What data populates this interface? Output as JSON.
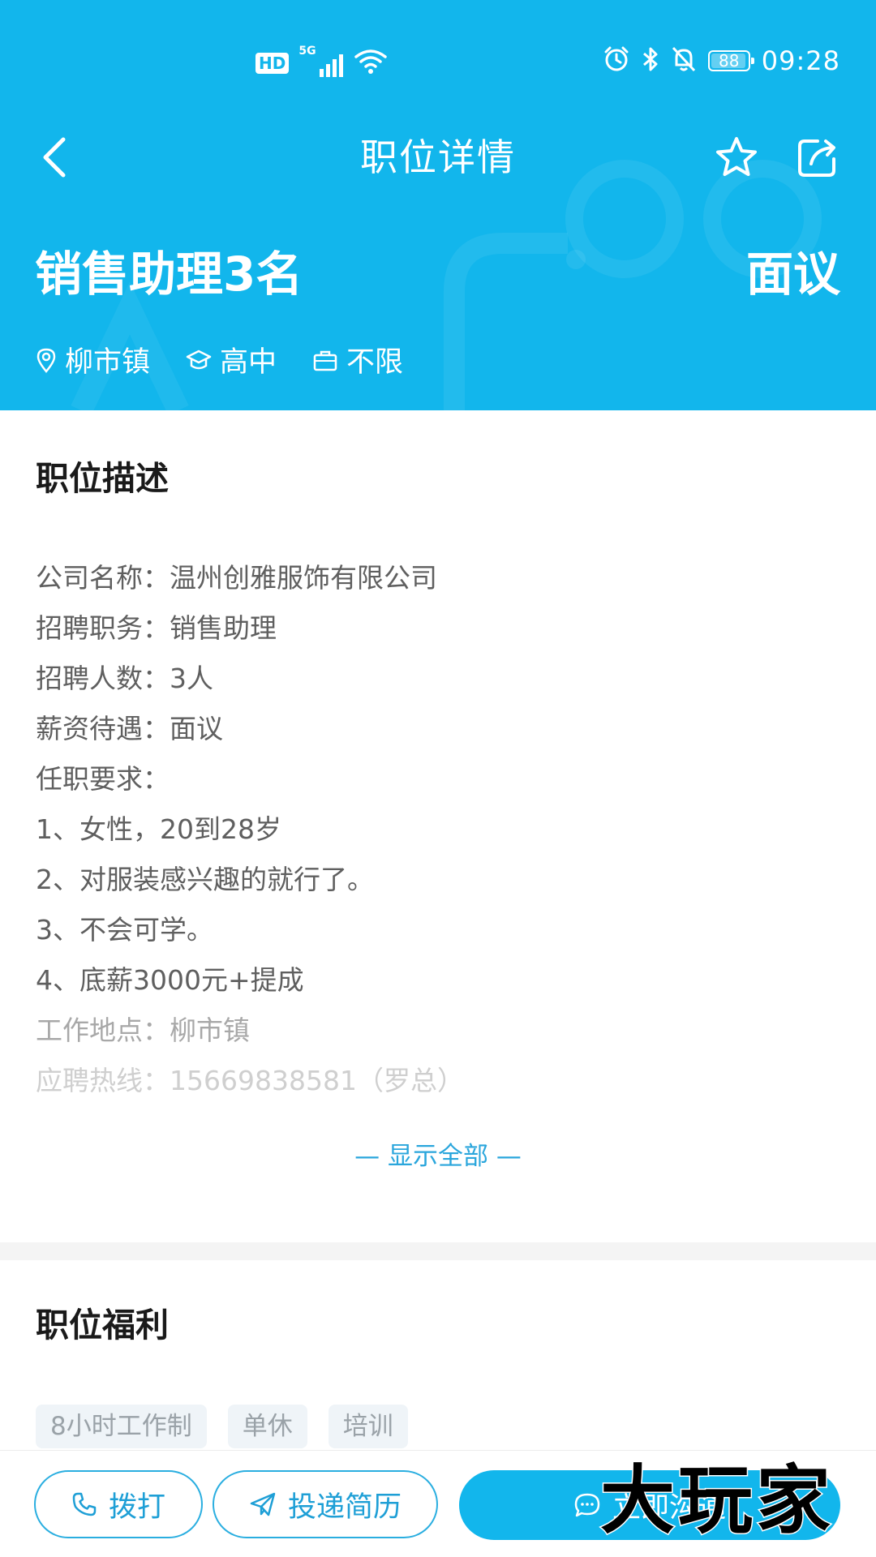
{
  "status_bar": {
    "hd_label": "HD",
    "network_label": "5G",
    "battery_level": "88",
    "time": "09:28"
  },
  "nav": {
    "title": "职位详情"
  },
  "job": {
    "title": "销售助理3名",
    "salary": "面议",
    "location": "柳市镇",
    "education": "高中",
    "experience": "不限"
  },
  "description": {
    "section_title": "职位描述",
    "lines": [
      "公司名称：温州创雅服饰有限公司",
      "招聘职务：销售助理",
      "招聘人数：3人",
      "薪资待遇：面议",
      "任职要求：",
      "1、女性，20到28岁",
      "2、对服装感兴趣的就行了。",
      "3、不会可学。",
      "4、底薪3000元+提成",
      "工作地点：柳市镇",
      "应聘热线：15669838581（罗总）"
    ],
    "show_all_label": "— 显示全部 —"
  },
  "benefits": {
    "section_title": "职位福利",
    "tags": [
      "8小时工作制",
      "单休",
      "培训"
    ]
  },
  "bottom_bar": {
    "call_label": "拨打",
    "resume_label": "投递简历",
    "chat_label": "立即沟通"
  },
  "brand": {
    "watermark_text": "大玩家"
  },
  "colors": {
    "primary": "#12b6ec",
    "accent_text": "#1e9fd6",
    "tag_bg": "#eff4f8"
  }
}
